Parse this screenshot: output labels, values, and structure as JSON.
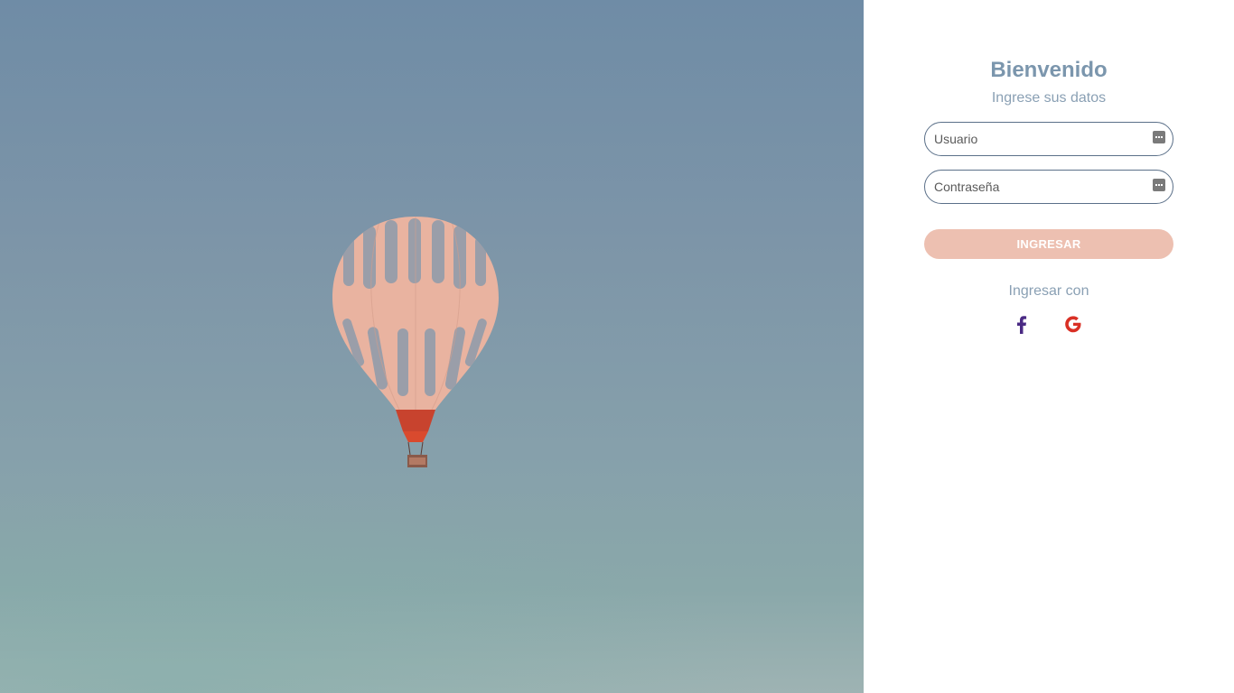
{
  "login": {
    "title": "Bienvenido",
    "subtitle": "Ingrese sus datos",
    "username_placeholder": "Usuario",
    "password_placeholder": "Contraseña",
    "submit_label": "INGRESAR",
    "alt_login_label": "Ingresar con",
    "social": [
      {
        "icon": "facebook-icon",
        "color": "#4a2a84"
      },
      {
        "icon": "google-icon",
        "color": "#d93025"
      }
    ]
  },
  "colors": {
    "accent": "#7b96ad",
    "button": "#edc0b1",
    "field_border": "#5b7089"
  },
  "hero": {
    "icon": "hot-air-balloon-image"
  }
}
